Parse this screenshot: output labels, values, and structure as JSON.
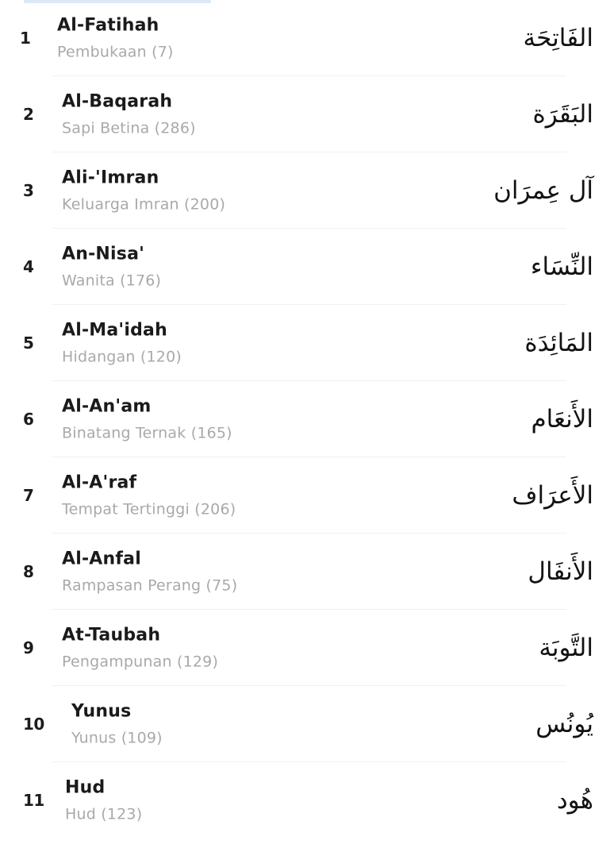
{
  "surahs": [
    {
      "number": "1",
      "name": "Al-Fatihah",
      "meaning": "Pembukaan (7)",
      "arabic": "الفَاتِحَة"
    },
    {
      "number": "2",
      "name": "Al-Baqarah",
      "meaning": "Sapi Betina (286)",
      "arabic": "البَقَرَة"
    },
    {
      "number": "3",
      "name": "Ali-'Imran",
      "meaning": "Keluarga Imran (200)",
      "arabic": "آل عِمرَان"
    },
    {
      "number": "4",
      "name": "An-Nisa'",
      "meaning": "Wanita (176)",
      "arabic": "النِّسَاء"
    },
    {
      "number": "5",
      "name": "Al-Ma'idah",
      "meaning": "Hidangan (120)",
      "arabic": "المَائِدَة"
    },
    {
      "number": "6",
      "name": "Al-An'am",
      "meaning": "Binatang Ternak (165)",
      "arabic": "الأَنعَام"
    },
    {
      "number": "7",
      "name": "Al-A'raf",
      "meaning": "Tempat Tertinggi (206)",
      "arabic": "الأَعرَاف"
    },
    {
      "number": "8",
      "name": "Al-Anfal",
      "meaning": "Rampasan Perang (75)",
      "arabic": "الأَنفَال"
    },
    {
      "number": "9",
      "name": "At-Taubah",
      "meaning": "Pengampunan (129)",
      "arabic": "التَّوبَة"
    },
    {
      "number": "10",
      "name": "Yunus",
      "meaning": "Yunus (109)",
      "arabic": "يُونُس"
    },
    {
      "number": "11",
      "name": "Hud",
      "meaning": "Hud (123)",
      "arabic": "هُود"
    }
  ]
}
